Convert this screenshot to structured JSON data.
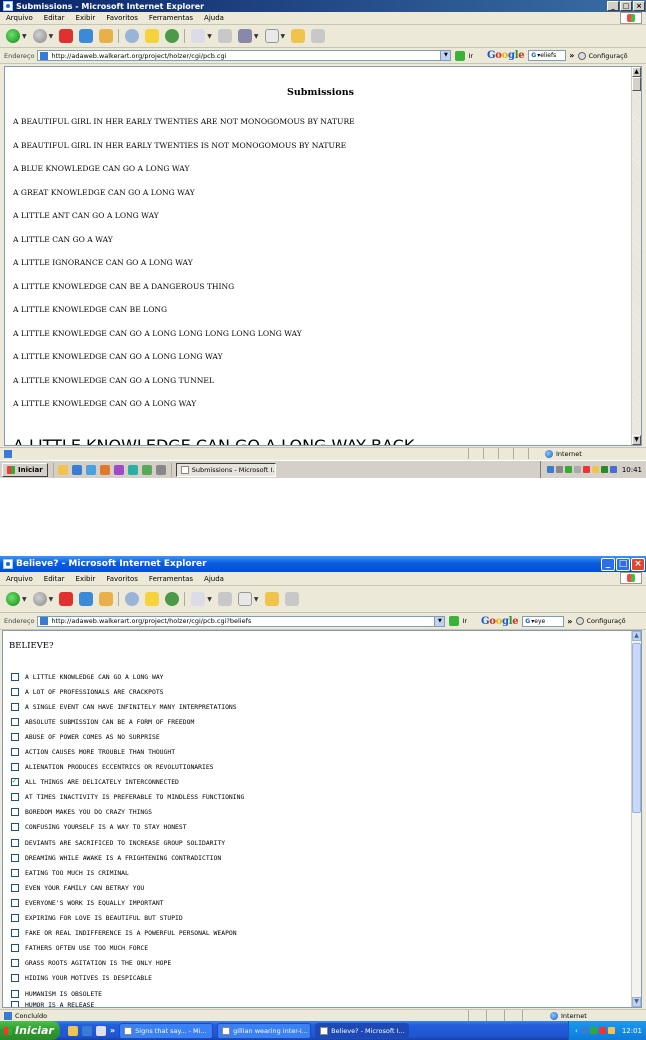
{
  "window1": {
    "title": "Submissions - Microsoft Internet Explorer",
    "menu": [
      "Arquivo",
      "Editar",
      "Exibir",
      "Favoritos",
      "Ferramentas",
      "Ajuda"
    ],
    "address_label": "Endereço",
    "address_url": "http://adaweb.walkerart.org/project/holzer/cgi/pcb.cgi",
    "go_label": "Ir",
    "google_query": "eliefs",
    "config_label": "Configuraçõ",
    "heading": "Submissions",
    "submissions": [
      "A BEAUTIFUL GIRL IN HER EARLY TWENTIES ARE NOT MONOGOMOUS BY NATURE",
      "A BEAUTIFUL GIRL IN HER EARLY TWENTIES IS NOT MONOGOMOUS BY NATURE",
      "A BLUE KNOWLEDGE CAN GO A LONG WAY",
      "A GREAT KNOWLEDGE CAN GO A LONG WAY",
      "A LITTLE ANT CAN GO A LONG WAY",
      "A LITTLE CAN GO A WAY",
      "A LITTLE IGNORANCE CAN GO A LONG WAY",
      "A LITTLE KNOWLEDGE CAN BE A DANGEROUS THING",
      "A LITTLE KNOWLEDGE CAN BE LONG",
      "A LITTLE KNOWLEDGE CAN GO A LONG LONG LONG LONG LONG WAY",
      "A LITTLE KNOWLEDGE CAN GO A LONG LONG WAY",
      "A LITTLE KNOWLEDGE CAN GO A LONG TUNNEL",
      "A LITTLE KNOWLEDGE CAN GO A LONG WAY"
    ],
    "status_zone": "Internet",
    "start_label": "Iniciar",
    "task_label": "Submissions - Microsoft I...",
    "clock": "10:41"
  },
  "window2": {
    "title": "Believe? - Microsoft Internet Explorer",
    "menu": [
      "Arquivo",
      "Editar",
      "Exibir",
      "Favoritos",
      "Ferramentas",
      "Ajuda"
    ],
    "address_label": "Endereço",
    "address_url": "http://adaweb.walkerart.org/project/holzer/cgi/pcb.cgi?beliefs",
    "go_label": "Ir",
    "google_query": "eye",
    "config_label": "Configuraçõ",
    "heading": "BELIEVE?",
    "beliefs": [
      {
        "text": "A LITTLE KNOWLEDGE CAN GO A LONG WAY",
        "checked": false
      },
      {
        "text": "A LOT OF PROFESSIONALS ARE CRACKPOTS",
        "checked": false
      },
      {
        "text": "A SINGLE EVENT CAN HAVE INFINITELY MANY INTERPRETATIONS",
        "checked": false
      },
      {
        "text": "ABSOLUTE SUBMISSION CAN BE A FORM OF FREEDOM",
        "checked": false
      },
      {
        "text": "ABUSE OF POWER COMES AS NO SURPRISE",
        "checked": false
      },
      {
        "text": "ACTION CAUSES MORE TROUBLE THAN THOUGHT",
        "checked": false
      },
      {
        "text": "ALIENATION PRODUCES ECCENTRICS OR REVOLUTIONARIES",
        "checked": false
      },
      {
        "text": "ALL THINGS ARE DELICATELY INTERCONNECTED",
        "checked": true
      },
      {
        "text": "AT TIMES INACTIVITY IS PREFERABLE TO MINDLESS FUNCTIONING",
        "checked": false
      },
      {
        "text": "BOREDOM MAKES YOU DO CRAZY THINGS",
        "checked": false
      },
      {
        "text": "CONFUSING YOURSELF IS A WAY TO STAY HONEST",
        "checked": false
      },
      {
        "text": "DEVIANTS ARE SACRIFICED TO INCREASE GROUP SOLIDARITY",
        "checked": false
      },
      {
        "text": "DREAMING WHILE AWAKE IS A FRIGHTENING CONTRADICTION",
        "checked": false
      },
      {
        "text": "EATING TOO MUCH IS CRIMINAL",
        "checked": false
      },
      {
        "text": "EVEN YOUR FAMILY CAN BETRAY YOU",
        "checked": false
      },
      {
        "text": "EVERYONE'S WORK IS EQUALLY IMPORTANT",
        "checked": false
      },
      {
        "text": "EXPIRING FOR LOVE IS BEAUTIFUL BUT STUPID",
        "checked": false
      },
      {
        "text": "FAKE OR REAL INDIFFERENCE IS A POWERFUL PERSONAL WEAPON",
        "checked": false
      },
      {
        "text": "FATHERS OFTEN USE TOO MUCH FORCE",
        "checked": false
      },
      {
        "text": "GRASS ROOTS AGITATION IS THE ONLY HOPE",
        "checked": false
      },
      {
        "text": "HIDING YOUR MOTIVES IS DESPICABLE",
        "checked": false
      },
      {
        "text": "HUMANISM IS OBSOLETE",
        "checked": false
      }
    ],
    "status_text": "Concluído",
    "status_zone": "Internet",
    "start_label": "Iniciar",
    "tasks": [
      "Signs that say... - Mi...",
      "gillian wearing inter-i...",
      "Believe? - Microsoft I..."
    ],
    "clock": "12:01"
  }
}
